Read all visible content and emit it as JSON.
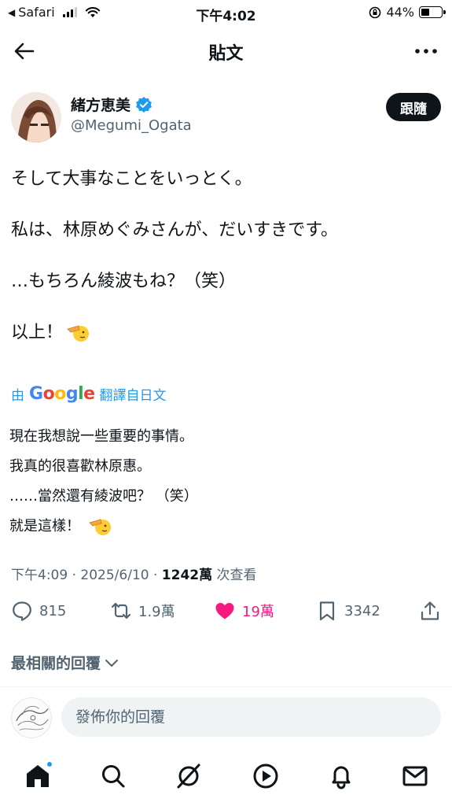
{
  "status_bar": {
    "back_app": "Safari",
    "time": "下午4:02",
    "battery": "44%",
    "battery_level": 0.44
  },
  "header": {
    "title": "貼文"
  },
  "author": {
    "name": "緒方恵美",
    "handle": "@Megumi_Ogata",
    "follow_label": "跟隨"
  },
  "tweet": {
    "lines": [
      "そして大事なことをいっとく。",
      "私は、林原めぐみさんが、だいすきです。",
      "…もちろん綾波もね？（笑）",
      "以上！"
    ]
  },
  "translation": {
    "by": "由",
    "provider": "Google",
    "note": "翻譯自日文",
    "lines": [
      "現在我想說一些重要的事情。",
      "我真的很喜歡林原惠。",
      "……當然還有綾波吧？ （笑）",
      "就是這樣！"
    ]
  },
  "meta": {
    "time": "下午4:09",
    "sep1": " · ",
    "date": "2025/6/10",
    "sep2": " · ",
    "views": "1242萬",
    "views_suffix": " 次查看"
  },
  "actions": {
    "replies": "815",
    "reposts": "1.9萬",
    "likes": "19萬",
    "bookmarks": "3342"
  },
  "replies_sort": {
    "label": "最相關的回覆"
  },
  "composer": {
    "placeholder": "發佈你的回覆"
  },
  "colors": {
    "accent": "#1d9bf0",
    "like": "#f91880",
    "text": "#0f1419",
    "muted": "#536471"
  },
  "tabbar": {
    "icons": [
      "home-icon",
      "search-icon",
      "grok-icon",
      "video-icon",
      "bell-icon",
      "mail-icon"
    ]
  }
}
